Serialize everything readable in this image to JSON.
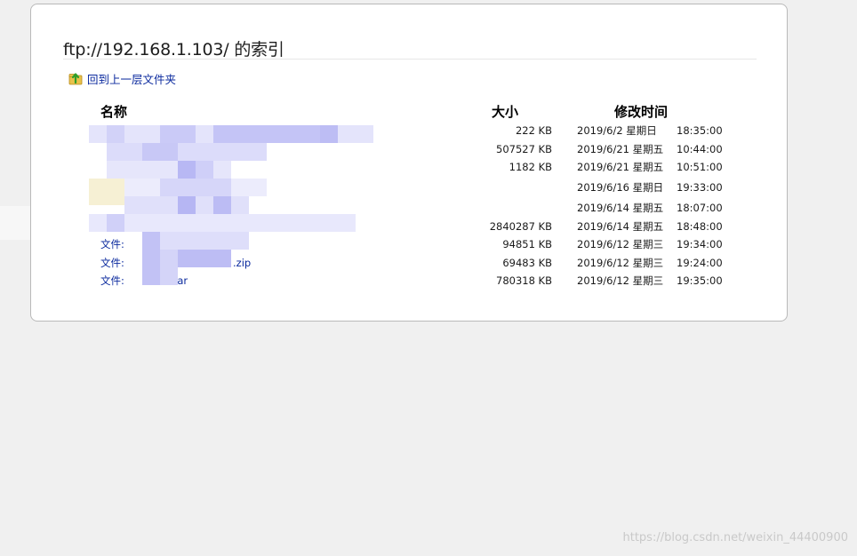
{
  "page": {
    "title": "ftp://192.168.1.103/ 的索引",
    "up_link": "回到上一层文件夹",
    "up_icon": "folder-up-icon",
    "watermark": "https://blog.csdn.net/weixin_44400900"
  },
  "columns": {
    "name": "名称",
    "size": "大小",
    "modified": "修改时间"
  },
  "rows": [
    {
      "name": "",
      "size": "222 KB",
      "date": "2019/6/2 星期日",
      "time": "18:35:00"
    },
    {
      "name": "",
      "size": "507527 KB",
      "date": "2019/6/21 星期五",
      "time": "10:44:00"
    },
    {
      "name": "",
      "size": "1182 KB",
      "date": "2019/6/21 星期五",
      "time": "10:51:00"
    },
    {
      "name": "",
      "size": "",
      "date": "2019/6/16 星期日",
      "time": "19:33:00"
    },
    {
      "name": "",
      "size": "",
      "date": "2019/6/14 星期五",
      "time": "18:07:00"
    },
    {
      "name": "",
      "size": "2840287 KB",
      "date": "2019/6/14 星期五",
      "time": "18:48:00"
    },
    {
      "name": "文件:",
      "size": "94851 KB",
      "date": "2019/6/12 星期三",
      "time": "19:34:00"
    },
    {
      "name": "文件:",
      "size": "69483 KB",
      "date": "2019/6/12 星期三",
      "time": "19:24:00"
    },
    {
      "name": "文件:",
      "size": "780318 KB",
      "date": "2019/6/12 星期三",
      "time": "19:35:00"
    }
  ],
  "row_suffixes": {
    "row7": ".zip",
    "row8": ".rar"
  },
  "colors": {
    "link": "#0b2a9e",
    "mosaic": "#b8b8f4"
  }
}
